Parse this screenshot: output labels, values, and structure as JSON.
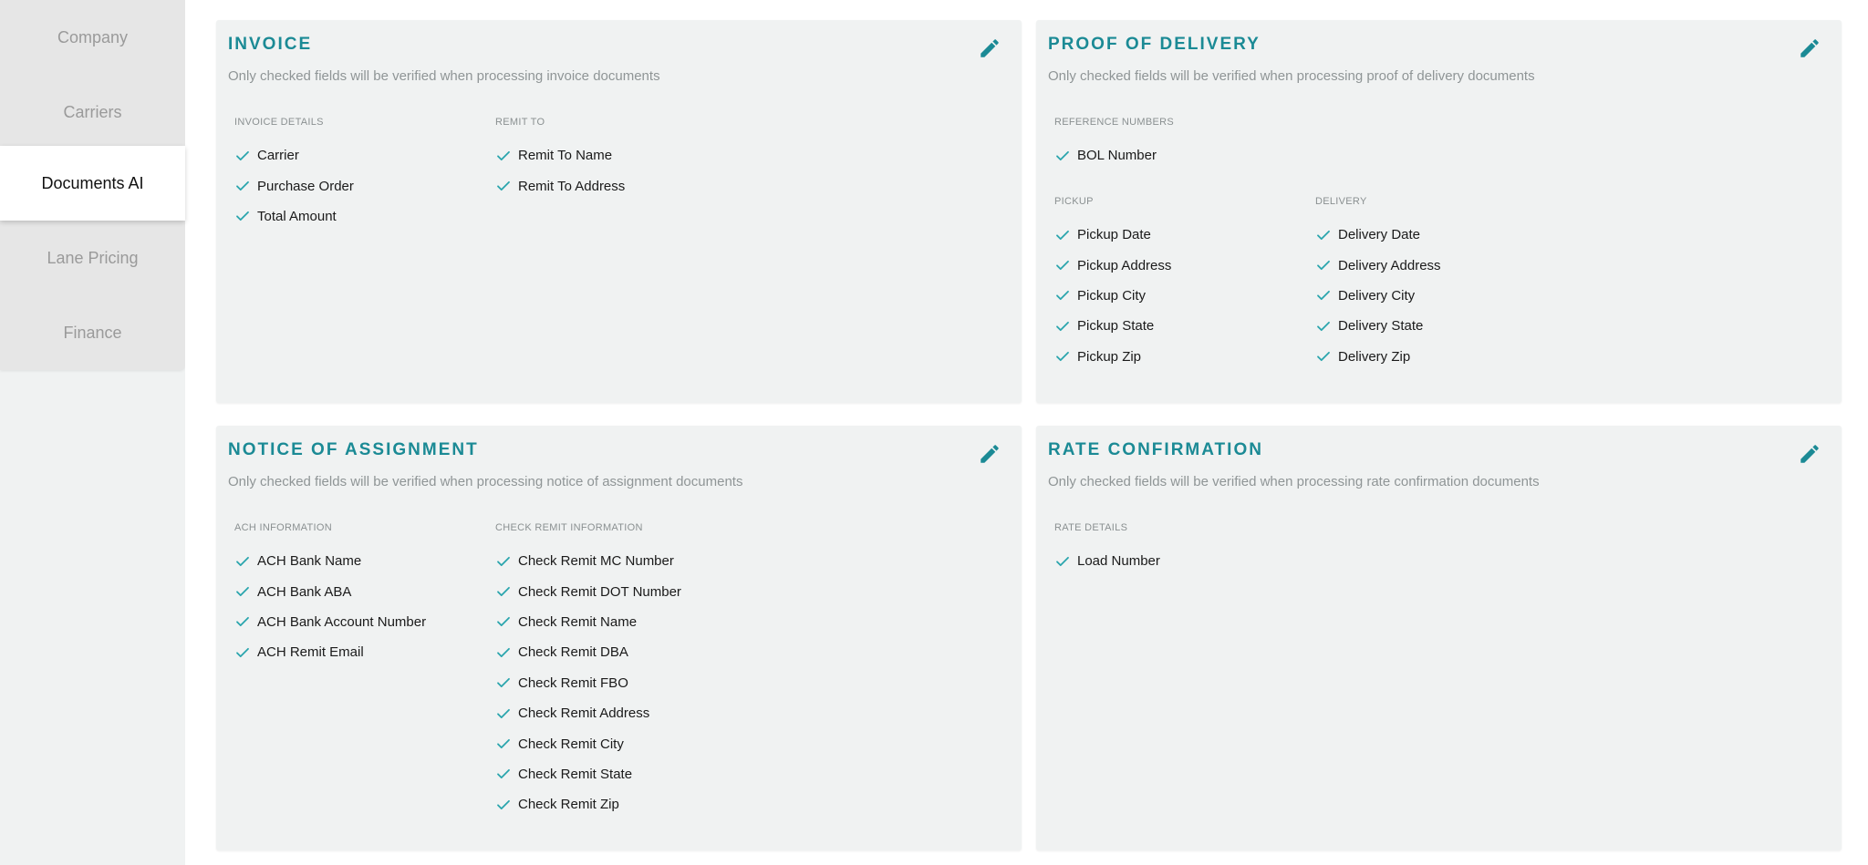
{
  "sidebar": {
    "items": [
      {
        "label": "Company",
        "active": false
      },
      {
        "label": "Carriers",
        "active": false
      },
      {
        "label": "Documents AI",
        "active": true
      },
      {
        "label": "Lane Pricing",
        "active": false
      },
      {
        "label": "Finance",
        "active": false
      }
    ]
  },
  "colors": {
    "accent": "#1b8a95",
    "check": "#2aa5ad",
    "card_bg": "#f0f2f2"
  },
  "cards": {
    "invoice": {
      "title": "INVOICE",
      "subtitle": "Only checked fields will be verified when processing invoice documents",
      "groups": [
        {
          "header": "INVOICE DETAILS",
          "fields": [
            "Carrier",
            "Purchase Order",
            "Total Amount"
          ]
        },
        {
          "header": "REMIT TO",
          "fields": [
            "Remit To Name",
            "Remit To Address"
          ]
        }
      ]
    },
    "pod": {
      "title": "PROOF OF DELIVERY",
      "subtitle": "Only checked fields will be verified when processing proof of delivery documents",
      "groups": [
        {
          "header": "REFERENCE NUMBERS",
          "fields": [
            "BOL Number"
          ]
        },
        {
          "header": "PICKUP",
          "fields": [
            "Pickup Date",
            "Pickup Address",
            "Pickup City",
            "Pickup State",
            "Pickup Zip"
          ]
        },
        {
          "header": "DELIVERY",
          "fields": [
            "Delivery Date",
            "Delivery Address",
            "Delivery City",
            "Delivery State",
            "Delivery Zip"
          ]
        }
      ]
    },
    "noa": {
      "title": "NOTICE OF ASSIGNMENT",
      "subtitle": "Only checked fields will be verified when processing notice of assignment documents",
      "groups": [
        {
          "header": "ACH INFORMATION",
          "fields": [
            "ACH Bank Name",
            "ACH Bank ABA",
            "ACH Bank Account Number",
            "ACH Remit Email"
          ]
        },
        {
          "header": "CHECK REMIT INFORMATION",
          "fields": [
            "Check Remit MC Number",
            "Check Remit DOT Number",
            "Check Remit Name",
            "Check Remit DBA",
            "Check Remit FBO",
            "Check Remit Address",
            "Check Remit City",
            "Check Remit State",
            "Check Remit Zip"
          ]
        }
      ]
    },
    "rate": {
      "title": "RATE CONFIRMATION",
      "subtitle": "Only checked fields will be verified when processing rate confirmation documents",
      "groups": [
        {
          "header": "RATE DETAILS",
          "fields": [
            "Load Number"
          ]
        }
      ]
    }
  }
}
